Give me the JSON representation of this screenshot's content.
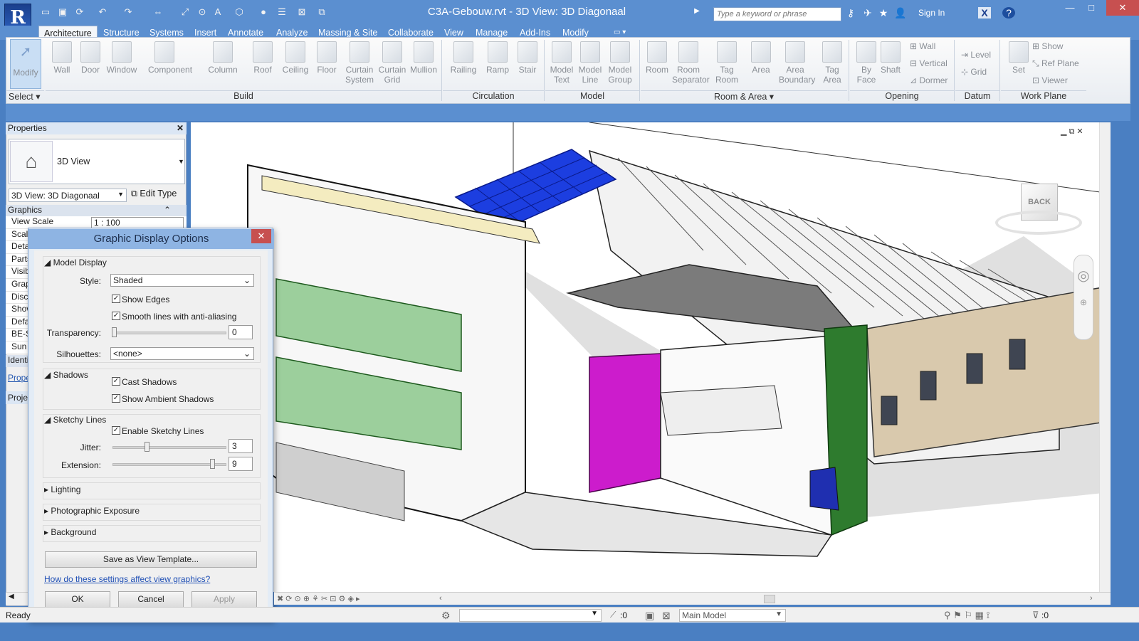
{
  "app": {
    "title": "C3A-Gebouw.rvt - 3D View: 3D Diagonaal",
    "app_icon": "R",
    "search_placeholder": "Type a keyword or phrase",
    "sign_in": "Sign In"
  },
  "tabs": [
    "Architecture",
    "Structure",
    "Systems",
    "Insert",
    "Annotate",
    "Analyze",
    "Massing & Site",
    "Collaborate",
    "View",
    "Manage",
    "Add-Ins",
    "Modify"
  ],
  "ribbon": {
    "modify": "Modify",
    "select": "Select",
    "build": [
      {
        "l1": "Wall",
        "l2": ""
      },
      {
        "l1": "Door",
        "l2": ""
      },
      {
        "l1": "Window",
        "l2": ""
      },
      {
        "l1": "Component",
        "l2": ""
      },
      {
        "l1": "Column",
        "l2": ""
      },
      {
        "l1": "Roof",
        "l2": ""
      },
      {
        "l1": "Ceiling",
        "l2": ""
      },
      {
        "l1": "Floor",
        "l2": ""
      },
      {
        "l1": "Curtain",
        "l2": "System"
      },
      {
        "l1": "Curtain",
        "l2": "Grid"
      },
      {
        "l1": "Mullion",
        "l2": ""
      }
    ],
    "circulation": [
      {
        "l1": "Railing",
        "l2": ""
      },
      {
        "l1": "Ramp",
        "l2": ""
      },
      {
        "l1": "Stair",
        "l2": ""
      }
    ],
    "model": [
      {
        "l1": "Model",
        "l2": "Text"
      },
      {
        "l1": "Model",
        "l2": "Line"
      },
      {
        "l1": "Model",
        "l2": "Group"
      }
    ],
    "room": [
      {
        "l1": "Room",
        "l2": ""
      },
      {
        "l1": "Room",
        "l2": "Separator"
      },
      {
        "l1": "Tag",
        "l2": "Room"
      },
      {
        "l1": "Area",
        "l2": ""
      },
      {
        "l1": "Area",
        "l2": "Boundary"
      },
      {
        "l1": "Tag",
        "l2": "Area"
      }
    ],
    "opening": [
      {
        "l1": "By",
        "l2": "Face"
      },
      {
        "l1": "Shaft",
        "l2": ""
      }
    ],
    "opening_small": [
      "Wall",
      "Vertical",
      "Dormer"
    ],
    "datum_small": [
      "Level",
      "Grid"
    ],
    "workplane_set": "Set",
    "workplane_small": [
      "Show",
      "Ref  Plane",
      "Viewer"
    ],
    "panels": {
      "build": "Build",
      "circulation": "Circulation",
      "model": "Model",
      "room": "Room & Area",
      "opening": "Opening",
      "datum": "Datum",
      "workplane": "Work Plane"
    }
  },
  "properties": {
    "title": "Properties",
    "type_name": "3D View",
    "instance": "3D View: 3D Diagonaal",
    "edit_type": "Edit Type",
    "graphics": "Graphics",
    "rows": [
      {
        "k": "View Scale",
        "v": "1 : 100"
      },
      {
        "k": "Scale",
        "v": ""
      },
      {
        "k": "Detail",
        "v": ""
      },
      {
        "k": "Parts",
        "v": ""
      },
      {
        "k": "Visib",
        "v": ""
      },
      {
        "k": "Grap",
        "v": ""
      },
      {
        "k": "Disci",
        "v": ""
      },
      {
        "k": "Show",
        "v": ""
      },
      {
        "k": "Defa",
        "v": ""
      },
      {
        "k": "BE-S",
        "v": ""
      },
      {
        "k": "Sun",
        "v": ""
      }
    ],
    "identity": "Identi",
    "props_link": "Prope",
    "project": "Projec"
  },
  "dialog": {
    "title": "Graphic Display Options",
    "model_display": "Model Display",
    "style_label": "Style:",
    "style_value": "Shaded",
    "show_edges": "Show Edges",
    "smooth_lines": "Smooth lines with anti-aliasing",
    "transparency_label": "Transparency:",
    "transparency_value": "0",
    "silhouettes_label": "Silhouettes:",
    "silhouettes_value": "<none>",
    "shadows": "Shadows",
    "cast_shadows": "Cast Shadows",
    "ambient_shadows": "Show Ambient Shadows",
    "sketchy": "Sketchy Lines",
    "enable_sketchy": "Enable Sketchy Lines",
    "jitter_label": "Jitter:",
    "jitter_value": "3",
    "extension_label": "Extension:",
    "extension_value": "9",
    "lighting": "Lighting",
    "exposure": "Photographic Exposure",
    "background": "Background",
    "save_template": "Save as View Template...",
    "help_link": "How do these settings affect view graphics?",
    "ok": "OK",
    "cancel": "Cancel",
    "apply": "Apply"
  },
  "viewcube": {
    "face": "BACK"
  },
  "status": {
    "ready": "Ready",
    "model": "Main Model",
    "count1": ":0",
    "count2": ":0"
  }
}
